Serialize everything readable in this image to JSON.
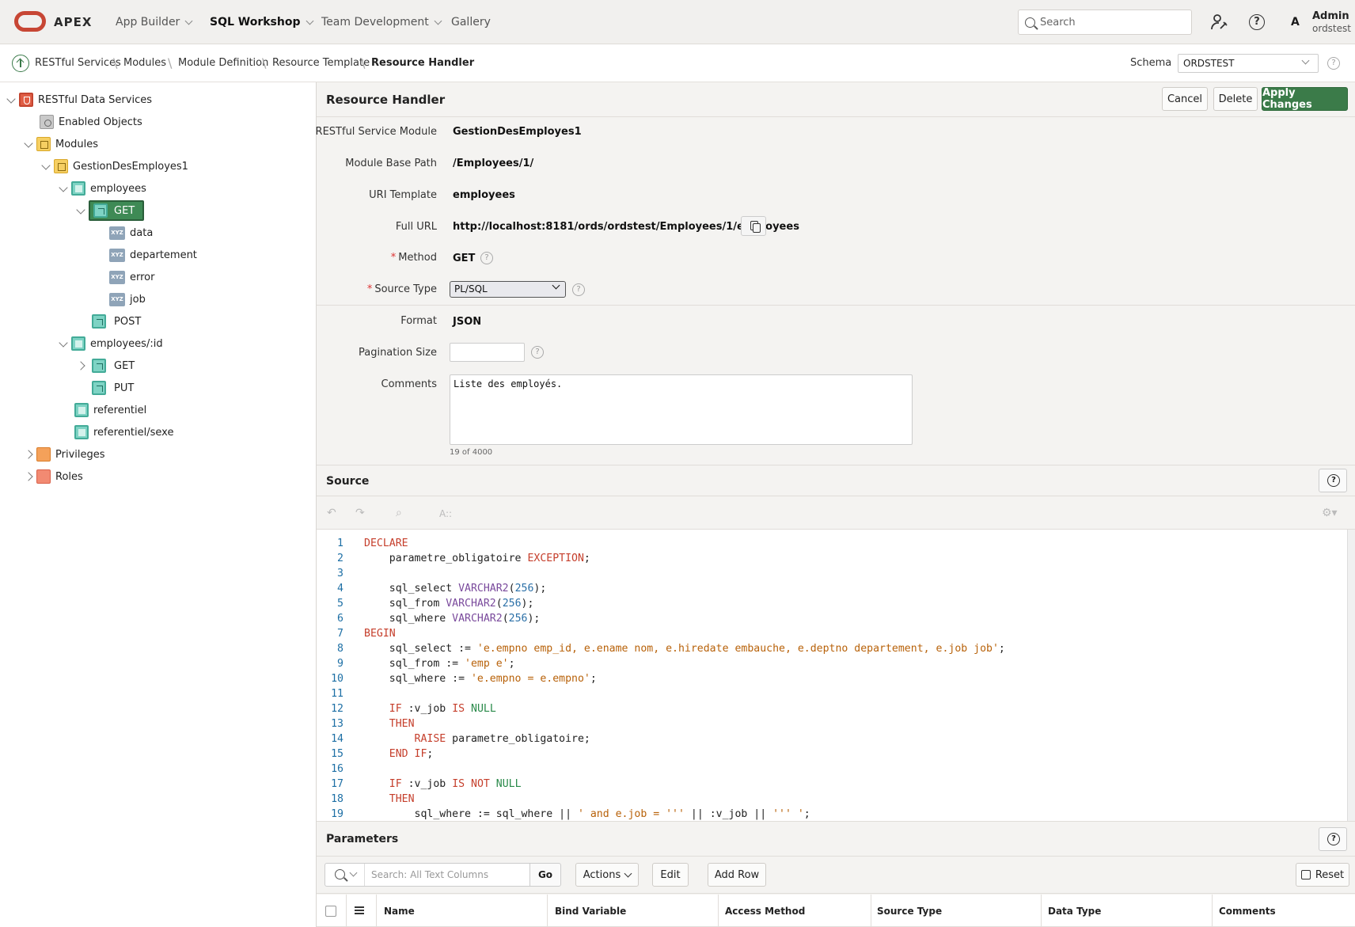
{
  "topbar": {
    "app_name": "APEX",
    "nav": [
      "App Builder",
      "SQL Workshop",
      "Team Development",
      "Gallery"
    ],
    "search_placeholder": "Search",
    "user_initial": "A",
    "user_name": "Admin",
    "user_schema": "ordstest"
  },
  "breadcrumb": [
    "RESTful Services",
    "Modules",
    "Module Definition",
    "Resource Template",
    "Resource Handler"
  ],
  "schema": {
    "label": "Schema",
    "value": "ORDSTEST"
  },
  "tree": {
    "root": "RESTful Data Services",
    "enabled_objects": "Enabled Objects",
    "modules": "Modules",
    "module": "GestionDesEmployes1",
    "t1": "employees",
    "t1_get": "GET",
    "params": [
      "data",
      "departement",
      "error",
      "job"
    ],
    "t1_post": "POST",
    "t2": "employees/:id",
    "t2_get": "GET",
    "t2_put": "PUT",
    "t3": "referentiel",
    "t4": "referentiel/sexe",
    "privileges": "Privileges",
    "roles": "Roles"
  },
  "handler": {
    "title": "Resource Handler",
    "cancel": "Cancel",
    "delete": "Delete",
    "apply": "Apply Changes",
    "labels": {
      "module": "RESTful Service Module",
      "base_path": "Module Base Path",
      "uri": "URI Template",
      "full_url": "Full URL",
      "method": "Method",
      "source_type": "Source Type",
      "format": "Format",
      "pagination": "Pagination Size",
      "comments": "Comments"
    },
    "values": {
      "module": "GestionDesEmployes1",
      "base_path": "/Employees/1/",
      "uri": "employees",
      "full_url": "http://localhost:8181/ords/ordstest/Employees/1/employees",
      "method": "GET",
      "source_type": "PL/SQL",
      "format": "JSON",
      "comments": "Liste des employés.",
      "char_count": "19 of 4000"
    }
  },
  "source": {
    "title": "Source",
    "font_label": "A::",
    "lines": [
      {
        "n": "1",
        "segs": [
          {
            "c": "k",
            "t": "DECLARE"
          }
        ]
      },
      {
        "n": "2",
        "segs": [
          {
            "c": "",
            "t": "    parametre_obligatoire "
          },
          {
            "c": "k",
            "t": "EXCEPTION"
          },
          {
            "c": "",
            "t": ";"
          }
        ]
      },
      {
        "n": "3",
        "segs": []
      },
      {
        "n": "4",
        "segs": [
          {
            "c": "",
            "t": "    sql_select "
          },
          {
            "c": "t",
            "t": "VARCHAR2"
          },
          {
            "c": "",
            "t": "("
          },
          {
            "c": "n",
            "t": "256"
          },
          {
            "c": "",
            "t": ");"
          }
        ]
      },
      {
        "n": "5",
        "segs": [
          {
            "c": "",
            "t": "    sql_from "
          },
          {
            "c": "t",
            "t": "VARCHAR2"
          },
          {
            "c": "",
            "t": "("
          },
          {
            "c": "n",
            "t": "256"
          },
          {
            "c": "",
            "t": ");"
          }
        ]
      },
      {
        "n": "6",
        "segs": [
          {
            "c": "",
            "t": "    sql_where "
          },
          {
            "c": "t",
            "t": "VARCHAR2"
          },
          {
            "c": "",
            "t": "("
          },
          {
            "c": "n",
            "t": "256"
          },
          {
            "c": "",
            "t": ");"
          }
        ]
      },
      {
        "n": "7",
        "segs": [
          {
            "c": "k",
            "t": "BEGIN"
          }
        ]
      },
      {
        "n": "8",
        "segs": [
          {
            "c": "",
            "t": "    sql_select := "
          },
          {
            "c": "s",
            "t": "'e.empno emp_id, e.ename nom, e.hiredate embauche, e.deptno departement, e.job job'"
          },
          {
            "c": "",
            "t": ";"
          }
        ]
      },
      {
        "n": "9",
        "segs": [
          {
            "c": "",
            "t": "    sql_from := "
          },
          {
            "c": "s",
            "t": "'emp e'"
          },
          {
            "c": "",
            "t": ";"
          }
        ]
      },
      {
        "n": "10",
        "segs": [
          {
            "c": "",
            "t": "    sql_where := "
          },
          {
            "c": "s",
            "t": "'e.empno = e.empno'"
          },
          {
            "c": "",
            "t": ";"
          }
        ]
      },
      {
        "n": "11",
        "segs": []
      },
      {
        "n": "12",
        "segs": [
          {
            "c": "",
            "t": "    "
          },
          {
            "c": "k",
            "t": "IF"
          },
          {
            "c": "",
            "t": " :v_job "
          },
          {
            "c": "k",
            "t": "IS"
          },
          {
            "c": "",
            "t": " "
          },
          {
            "c": "g",
            "t": "NULL"
          }
        ]
      },
      {
        "n": "13",
        "segs": [
          {
            "c": "",
            "t": "    "
          },
          {
            "c": "k",
            "t": "THEN"
          }
        ]
      },
      {
        "n": "14",
        "segs": [
          {
            "c": "",
            "t": "        "
          },
          {
            "c": "k",
            "t": "RAISE"
          },
          {
            "c": "",
            "t": " parametre_obligatoire;"
          }
        ]
      },
      {
        "n": "15",
        "segs": [
          {
            "c": "",
            "t": "    "
          },
          {
            "c": "k",
            "t": "END IF"
          },
          {
            "c": "",
            "t": ";"
          }
        ]
      },
      {
        "n": "16",
        "segs": []
      },
      {
        "n": "17",
        "segs": [
          {
            "c": "",
            "t": "    "
          },
          {
            "c": "k",
            "t": "IF"
          },
          {
            "c": "",
            "t": " :v_job "
          },
          {
            "c": "k",
            "t": "IS NOT"
          },
          {
            "c": "",
            "t": " "
          },
          {
            "c": "g",
            "t": "NULL"
          }
        ]
      },
      {
        "n": "18",
        "segs": [
          {
            "c": "",
            "t": "    "
          },
          {
            "c": "k",
            "t": "THEN"
          }
        ]
      },
      {
        "n": "19",
        "segs": [
          {
            "c": "",
            "t": "        sql_where := sql_where || "
          },
          {
            "c": "s",
            "t": "' and e.job = '''"
          },
          {
            "c": "",
            "t": " || :v_job || "
          },
          {
            "c": "s",
            "t": "''' '"
          },
          {
            "c": "",
            "t": ";"
          }
        ]
      }
    ]
  },
  "parameters": {
    "title": "Parameters",
    "search_placeholder": "Search: All Text Columns",
    "go": "Go",
    "actions": "Actions",
    "edit": "Edit",
    "add_row": "Add Row",
    "reset": "Reset",
    "columns": [
      "Name",
      "Bind Variable",
      "Access Method",
      "Source Type",
      "Data Type",
      "Comments"
    ]
  }
}
